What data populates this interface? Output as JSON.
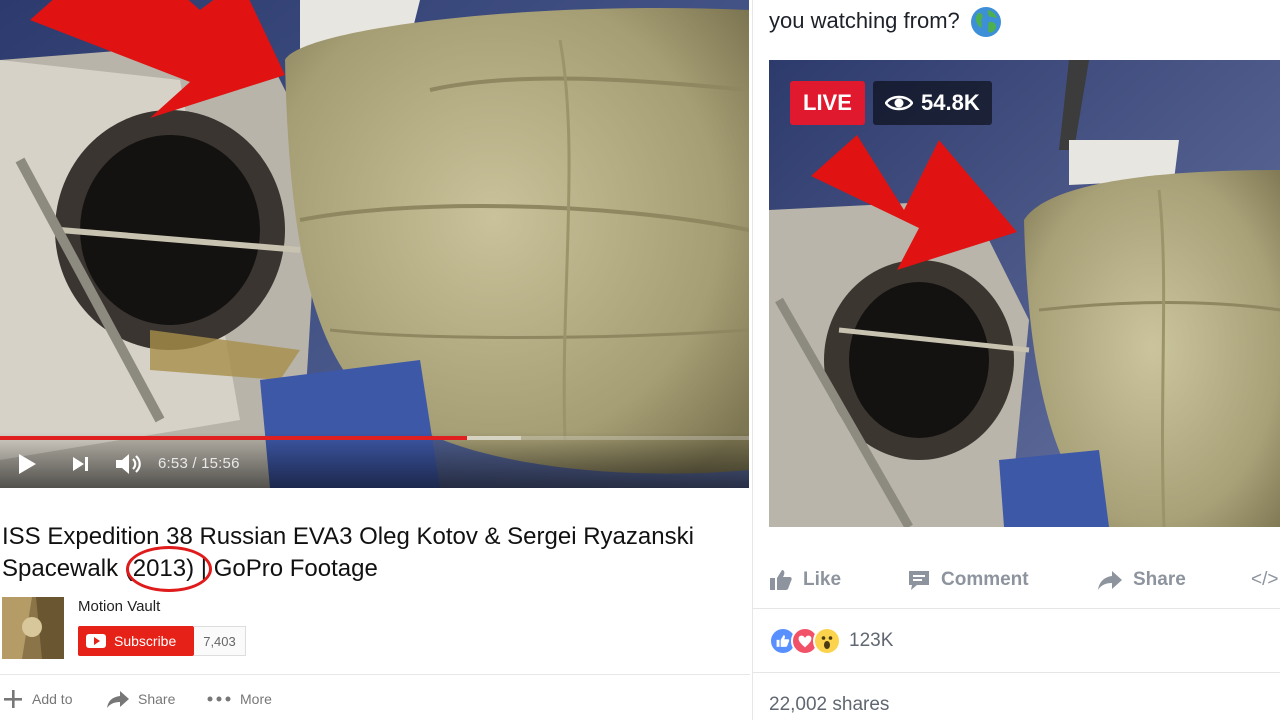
{
  "youtube": {
    "player": {
      "time_display": "6:53 / 15:56",
      "progress_fraction": 0.623,
      "buffer_fraction": 0.695
    },
    "title_before": "ISS Expedition 38 Russian EVA3 Oleg Kotov & Sergei Ryazanski Spacewalk ",
    "title_year": "(2013",
    "title_after": ") | GoPro Footage",
    "channel_name": "Motion Vault",
    "subscribe_label": "Subscribe",
    "subscriber_count": "7,403",
    "actions": {
      "add_to": "Add to",
      "share": "Share",
      "more": "More"
    }
  },
  "facebook": {
    "post_text": "you watching from?",
    "live_label": "LIVE",
    "viewer_count": "54.8K",
    "actions": {
      "like": "Like",
      "comment": "Comment",
      "share": "Share",
      "embed": "</>"
    },
    "reaction_count": "123K",
    "shares": "22,002 shares"
  },
  "colors": {
    "youtube_red": "#e62117",
    "progress_red": "#e02020",
    "annotation_red": "#e01b1b",
    "fb_live_red": "#e0192f",
    "fb_like_blue": "#5890ff",
    "fb_love_red": "#f25268",
    "fb_wow_yellow": "#fcd34d"
  }
}
